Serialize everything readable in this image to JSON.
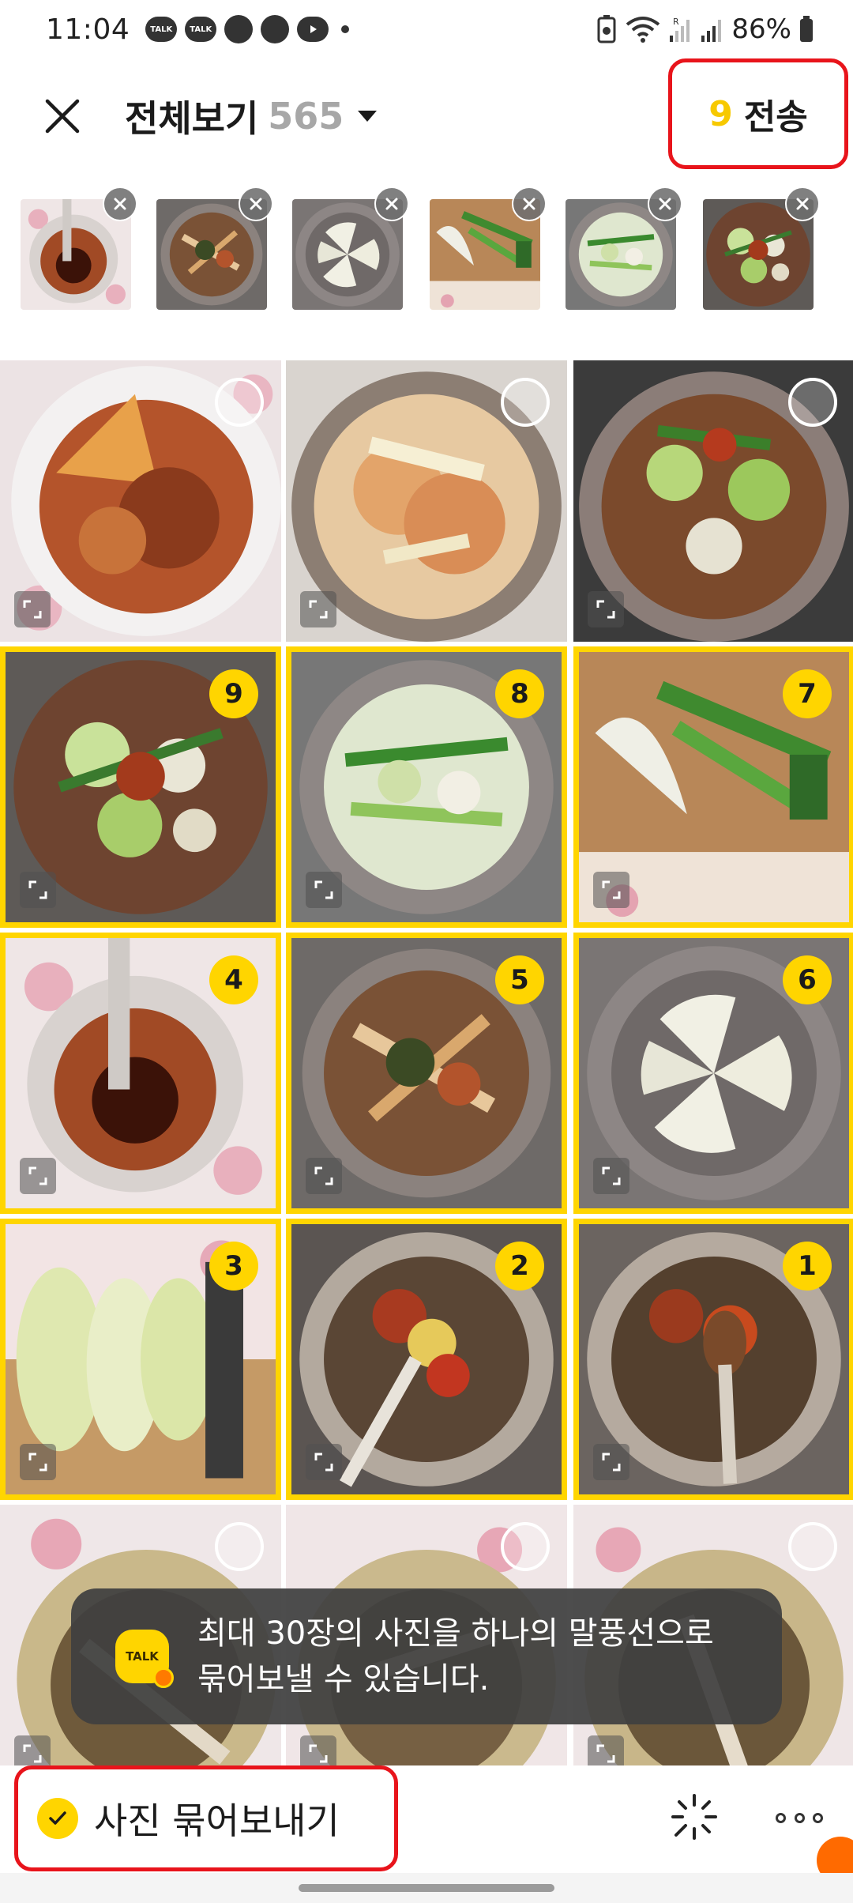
{
  "status_bar": {
    "time": "11:04",
    "notification_icons": [
      "TALK",
      "TALK",
      "chat-icon",
      "game-icon",
      "youtube-icon"
    ],
    "battery": "86%"
  },
  "header": {
    "title": "전체보기",
    "count": "565",
    "send_count": "9",
    "send_label": "전송"
  },
  "selected_thumbnails": [
    {
      "photo": "chili-sauce-bowl"
    },
    {
      "photo": "seasoned-greens"
    },
    {
      "photo": "radish-slices"
    },
    {
      "photo": "green-onion-cutting"
    },
    {
      "photo": "mixed-greens-pot"
    },
    {
      "photo": "kimchi-final"
    }
  ],
  "grid": [
    {
      "photo": "radish-kimchi-plate",
      "selected": false,
      "order": ""
    },
    {
      "photo": "kimchi-pot",
      "selected": false,
      "order": ""
    },
    {
      "photo": "kimchi-mixed-pot",
      "selected": false,
      "order": ""
    },
    {
      "photo": "kimchi-final",
      "selected": true,
      "order": "9"
    },
    {
      "photo": "mixed-greens-pot",
      "selected": true,
      "order": "8"
    },
    {
      "photo": "green-onion-cutting",
      "selected": true,
      "order": "7"
    },
    {
      "photo": "chili-sauce-bowl",
      "selected": true,
      "order": "4"
    },
    {
      "photo": "seasoned-greens",
      "selected": true,
      "order": "5"
    },
    {
      "photo": "radish-slices",
      "selected": true,
      "order": "6"
    },
    {
      "photo": "radish-wedges-board",
      "selected": true,
      "order": "3"
    },
    {
      "photo": "bowl-seasoning",
      "selected": true,
      "order": "2"
    },
    {
      "photo": "bowl-seasoning-spoon",
      "selected": true,
      "order": "1"
    },
    {
      "photo": "metal-bowl-1",
      "selected": false,
      "order": ""
    },
    {
      "photo": "metal-bowl-2",
      "selected": false,
      "order": ""
    },
    {
      "photo": "metal-bowl-3",
      "selected": false,
      "order": ""
    }
  ],
  "toast": {
    "logo_text": "TALK",
    "message": "최대 30장의 사진을 하나의 말풍선으로 묶어보낼 수 있습니다."
  },
  "bottom_bar": {
    "bundle_label": "사진 묶어보내기",
    "bundle_checked": true
  },
  "colors": {
    "accent_yellow": "#ffd500",
    "highlight_red": "#e8141b",
    "send_count_yellow": "#f7c900"
  }
}
